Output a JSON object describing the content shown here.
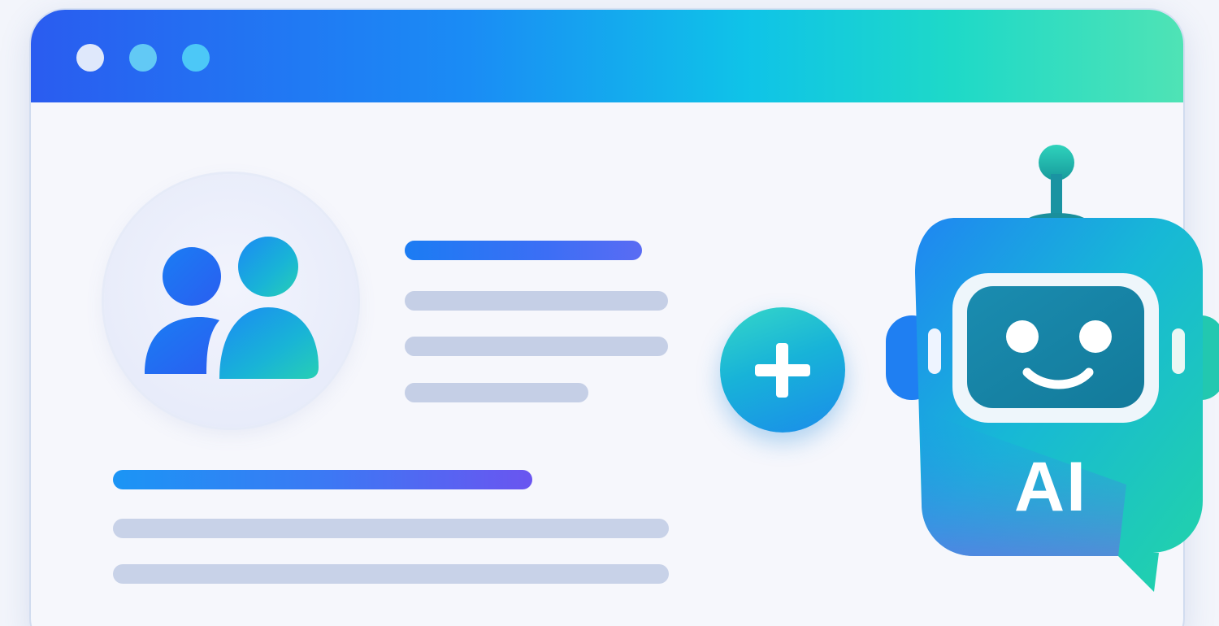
{
  "window": {
    "titlebar_dots": [
      "window-dot",
      "window-dot",
      "window-dot"
    ]
  },
  "colors": {
    "titlebar_gradient_start": "#2a5cf0",
    "titlebar_gradient_end": "#4fe3b5",
    "accent_blue": "#1b7cf3",
    "accent_teal": "#1ed9c8",
    "accent_purple": "#6a55f0",
    "placeholder_gray": "#c5cfe6"
  },
  "profile": {
    "icon": "users-icon"
  },
  "action": {
    "icon": "plus-icon"
  },
  "assistant": {
    "icon": "robot-icon",
    "label": "AI"
  }
}
